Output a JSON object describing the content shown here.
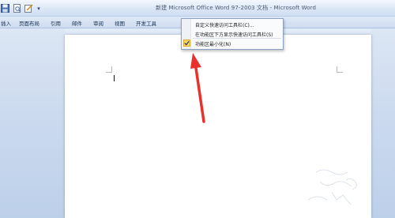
{
  "window": {
    "title": "新建 Microsoft Office Word 97-2003 文档 - Microsoft Word"
  },
  "quick_access": {
    "icons": [
      "save-icon",
      "print-preview-icon",
      "edit-icon"
    ],
    "dropdown_glyph": "▾"
  },
  "ribbon": {
    "tabs": [
      "插入",
      "页面布局",
      "引用",
      "邮件",
      "审阅",
      "视图",
      "开发工具"
    ]
  },
  "context_menu": {
    "items": [
      {
        "label": "自定义快速访问工具栏(C)...",
        "checked": false
      },
      {
        "label": "在功能区下方显示快速访问工具栏(S)",
        "checked": false
      },
      {
        "label": "功能区最小化(N)",
        "checked": true
      }
    ]
  },
  "colors": {
    "annotation_arrow": "#e8322b",
    "check_highlight": "#f7d46a"
  }
}
